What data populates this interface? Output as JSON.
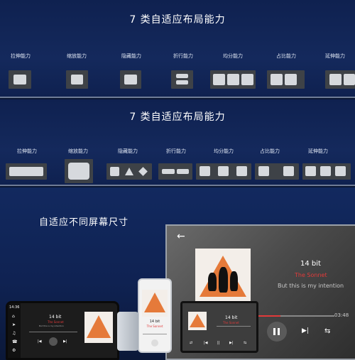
{
  "panel1": {
    "title": "7 类自适应布局能力",
    "labels": [
      "拉伸能力",
      "缩放能力",
      "隐藏能力",
      "折行能力",
      "均分能力",
      "占比能力",
      "延伸能力"
    ]
  },
  "panel2": {
    "title": "7 类自适应布局能力",
    "labels": [
      "拉伸能力",
      "缩放能力",
      "隐藏能力",
      "折行能力",
      "均分能力",
      "占比能力",
      "延伸能力"
    ]
  },
  "panel3": {
    "title": "自适应不同屏幕尺寸",
    "player": {
      "back_icon": "back-arrow-icon",
      "song": "14 bit",
      "artist": "The Sonnet",
      "subtitle": "But this is my intention",
      "time": "03:48",
      "progress": 0.3
    },
    "car": {
      "time": "14:36"
    }
  },
  "colors": {
    "accent": "#e23a3a",
    "box": "#3e4247",
    "tile": "#d6d9dd",
    "background": "#0f2150"
  }
}
